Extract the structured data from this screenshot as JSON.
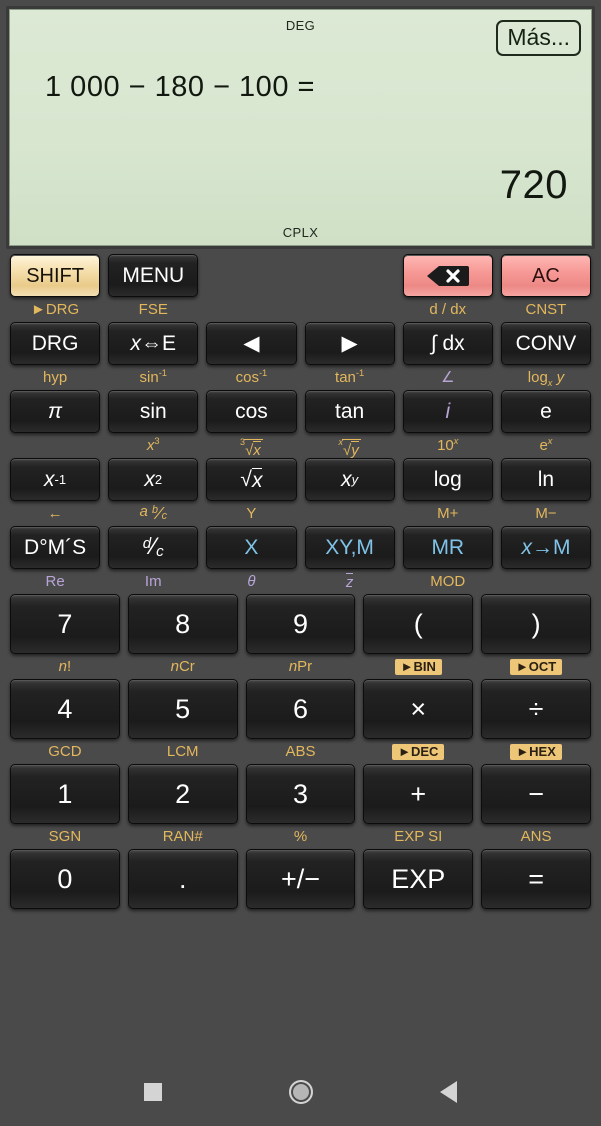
{
  "display": {
    "mode_top": "DEG",
    "mode_bottom": "CPLX",
    "more_button": "Más...",
    "expression": "1 000 − 180 − 100 =",
    "result": "720"
  },
  "keypad": {
    "rows": [
      {
        "labels": [
          {
            "text": "►DRG",
            "color": "amber"
          },
          {
            "text": "FSE",
            "color": "amber"
          },
          {
            "text": "",
            "color": "none"
          },
          {
            "text": "",
            "color": "none"
          },
          {
            "text": "d / dx",
            "color": "amber"
          },
          {
            "text": "CNST",
            "color": "amber"
          }
        ],
        "keys": [
          {
            "name": "shift",
            "label": "SHIFT",
            "style": "shift"
          },
          {
            "name": "menu",
            "label": "MENU",
            "style": "dark"
          },
          {
            "name": "spacer-1",
            "label": "",
            "style": "none"
          },
          {
            "name": "spacer-2",
            "label": "",
            "style": "none"
          },
          {
            "name": "backspace",
            "label": "",
            "style": "red-backspace"
          },
          {
            "name": "all-clear",
            "label": "AC",
            "style": "red"
          }
        ]
      },
      {
        "labels": [
          {
            "text": "hyp",
            "color": "amber"
          },
          {
            "text": "sin⁻¹",
            "color": "amber"
          },
          {
            "text": "cos⁻¹",
            "color": "amber"
          },
          {
            "text": "tan⁻¹",
            "color": "amber"
          },
          {
            "text": "∠",
            "color": "purple"
          },
          {
            "text": "logₓ y",
            "color": "amber"
          }
        ],
        "keys": [
          {
            "name": "drg",
            "label": "DRG",
            "style": "dark"
          },
          {
            "name": "x-swap-e",
            "label": "x⇔E",
            "style": "dark"
          },
          {
            "name": "cursor-left",
            "label": "◀",
            "style": "dark"
          },
          {
            "name": "cursor-right",
            "label": "▶",
            "style": "dark"
          },
          {
            "name": "integral-dx",
            "label": "∫dx",
            "style": "dark"
          },
          {
            "name": "conv",
            "label": "CONV",
            "style": "dark"
          }
        ]
      },
      {
        "labels": [
          {
            "text": "",
            "color": "none"
          },
          {
            "text": "x³",
            "color": "amber"
          },
          {
            "text": "³√x",
            "color": "amber"
          },
          {
            "text": "ˣ√y",
            "color": "amber"
          },
          {
            "text": "10ˣ",
            "color": "amber"
          },
          {
            "text": "eˣ",
            "color": "amber"
          }
        ],
        "keys": [
          {
            "name": "pi",
            "label": "π",
            "style": "dark"
          },
          {
            "name": "sin",
            "label": "sin",
            "style": "dark"
          },
          {
            "name": "cos",
            "label": "cos",
            "style": "dark"
          },
          {
            "name": "tan",
            "label": "tan",
            "style": "dark"
          },
          {
            "name": "imaginary-i",
            "label": "i",
            "style": "purple"
          },
          {
            "name": "euler-e",
            "label": "e",
            "style": "dark"
          }
        ]
      },
      {
        "labels": [
          {
            "text": "←",
            "color": "amber"
          },
          {
            "text": "a b/c",
            "color": "amber"
          },
          {
            "text": "Y",
            "color": "amber"
          },
          {
            "text": "",
            "color": "none"
          },
          {
            "text": "M+",
            "color": "amber"
          },
          {
            "text": "M−",
            "color": "amber"
          }
        ],
        "keys": [
          {
            "name": "x-inverse",
            "label": "x⁻¹",
            "style": "dark"
          },
          {
            "name": "x-squared",
            "label": "x²",
            "style": "dark"
          },
          {
            "name": "square-root",
            "label": "√x",
            "style": "dark"
          },
          {
            "name": "x-power-y",
            "label": "xʸ",
            "style": "dark"
          },
          {
            "name": "log",
            "label": "log",
            "style": "dark"
          },
          {
            "name": "ln",
            "label": "ln",
            "style": "dark"
          }
        ]
      },
      {
        "labels": [
          {
            "text": "Re",
            "color": "purple"
          },
          {
            "text": "Im",
            "color": "purple"
          },
          {
            "text": "θ",
            "color": "purple"
          },
          {
            "text": "z̄",
            "color": "purple"
          },
          {
            "text": "MOD",
            "color": "amber"
          },
          {
            "text": "",
            "color": "none"
          }
        ],
        "keys": [
          {
            "name": "degrees-minutes-seconds",
            "label": "D°M´S",
            "style": "dark"
          },
          {
            "name": "fraction-d-c",
            "label": "d/c",
            "style": "dark"
          },
          {
            "name": "variable-x",
            "label": "X",
            "style": "blue"
          },
          {
            "name": "xy-memory",
            "label": "XY,M",
            "style": "blue"
          },
          {
            "name": "memory-recall",
            "label": "MR",
            "style": "blue"
          },
          {
            "name": "store-to-memory",
            "label": "x→M",
            "style": "blue"
          }
        ]
      }
    ],
    "numeric_rows": [
      {
        "labels": [
          {
            "text": "n!",
            "color": "amber",
            "chip": false
          },
          {
            "text": "nCr",
            "color": "amber",
            "chip": false
          },
          {
            "text": "nPr",
            "color": "amber",
            "chip": false
          },
          {
            "text": "►BIN",
            "color": "amber",
            "chip": true
          },
          {
            "text": "►OCT",
            "color": "amber",
            "chip": true
          }
        ],
        "keys": [
          {
            "name": "digit-7",
            "label": "7"
          },
          {
            "name": "digit-8",
            "label": "8"
          },
          {
            "name": "digit-9",
            "label": "9"
          },
          {
            "name": "paren-open",
            "label": "("
          },
          {
            "name": "paren-close",
            "label": ")"
          }
        ]
      },
      {
        "labels": [
          {
            "text": "GCD",
            "color": "amber",
            "chip": false
          },
          {
            "text": "LCM",
            "color": "amber",
            "chip": false
          },
          {
            "text": "ABS",
            "color": "amber",
            "chip": false
          },
          {
            "text": "►DEC",
            "color": "amber",
            "chip": true
          },
          {
            "text": "►HEX",
            "color": "amber",
            "chip": true
          }
        ],
        "keys": [
          {
            "name": "digit-4",
            "label": "4"
          },
          {
            "name": "digit-5",
            "label": "5"
          },
          {
            "name": "digit-6",
            "label": "6"
          },
          {
            "name": "multiply",
            "label": "×"
          },
          {
            "name": "divide",
            "label": "÷"
          }
        ]
      },
      {
        "labels": [
          {
            "text": "SGN",
            "color": "amber",
            "chip": false
          },
          {
            "text": "RAN#",
            "color": "amber",
            "chip": false
          },
          {
            "text": "%",
            "color": "amber",
            "chip": false
          },
          {
            "text": "EXP SI",
            "color": "amber",
            "chip": false
          },
          {
            "text": "ANS",
            "color": "amber",
            "chip": false
          }
        ],
        "keys": [
          {
            "name": "digit-1",
            "label": "1"
          },
          {
            "name": "digit-2",
            "label": "2"
          },
          {
            "name": "digit-3",
            "label": "3"
          },
          {
            "name": "add",
            "label": "+"
          },
          {
            "name": "subtract",
            "label": "−"
          }
        ]
      },
      {
        "labels": [],
        "keys": [
          {
            "name": "digit-0",
            "label": "0"
          },
          {
            "name": "decimal-point",
            "label": "."
          },
          {
            "name": "sign-toggle",
            "label": "+/−"
          },
          {
            "name": "exponent",
            "label": "EXP"
          },
          {
            "name": "equals",
            "label": "="
          }
        ]
      }
    ]
  },
  "navbar": {
    "recents": "recents-square",
    "home": "home-circle",
    "back": "back-triangle"
  }
}
